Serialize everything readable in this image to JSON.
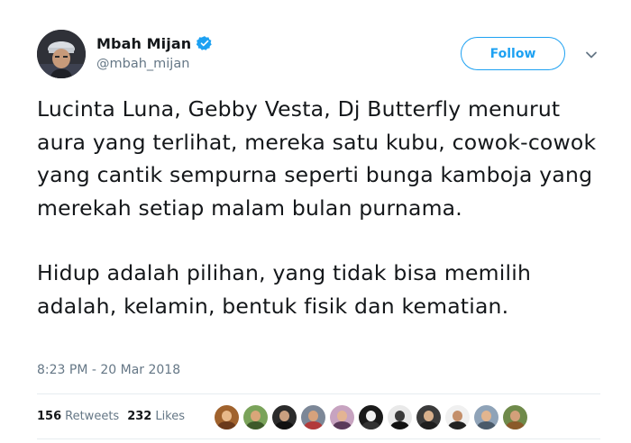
{
  "user": {
    "display_name": "Mbah Mijan",
    "handle": "@mbah_mijan",
    "verified": true,
    "avatar_icon": "profile-avatar"
  },
  "actions": {
    "follow_label": "Follow",
    "menu_icon": "chevron-down-icon"
  },
  "tweet": {
    "paragraphs": [
      "Lucinta Luna, Gebby Vesta, Dj Butterfly menurut aura yang terlihat, mereka satu kubu, cowok-cowok yang cantik sempurna seperti bunga kamboja yang merekah setiap malam bulan purnama.",
      "Hidup adalah pilihan, yang tidak bisa memilih adalah, kelamin, bentuk fisik dan kematian."
    ],
    "timestamp": "8:23 PM - 20 Mar 2018"
  },
  "stats": {
    "retweets_count": "156",
    "retweets_label": "Retweets",
    "likes_count": "232",
    "likes_label": "Likes"
  },
  "likers": [
    {
      "name": "liker-avatar-1",
      "bg": "#a0622d",
      "face": "#e8b98a",
      "body": "#6b3a1c"
    },
    {
      "name": "liker-avatar-2",
      "bg": "#7aa35a",
      "face": "#d9a679",
      "body": "#3e5a2a"
    },
    {
      "name": "liker-avatar-3",
      "bg": "#2b2b2b",
      "face": "#c9a080",
      "body": "#111111"
    },
    {
      "name": "liker-avatar-4",
      "bg": "#7c8797",
      "face": "#d6a27c",
      "body": "#b23a3a"
    },
    {
      "name": "liker-avatar-5",
      "bg": "#c7a3c0",
      "face": "#e3b493",
      "body": "#5a3a5a"
    },
    {
      "name": "liker-avatar-6",
      "bg": "#1a1a1a",
      "face": "#f2f2f2",
      "body": "#333333"
    },
    {
      "name": "liker-avatar-7",
      "bg": "#e9e9e9",
      "face": "#3a3a3a",
      "body": "#111111"
    },
    {
      "name": "liker-avatar-8",
      "bg": "#3b3b3b",
      "face": "#d8b08c",
      "body": "#1e1e1e"
    },
    {
      "name": "liker-avatar-9",
      "bg": "#f0f0f0",
      "face": "#c48f6a",
      "body": "#222222"
    },
    {
      "name": "liker-avatar-10",
      "bg": "#8fa3b8",
      "face": "#e2b58f",
      "body": "#4a5a6a"
    },
    {
      "name": "liker-avatar-11",
      "bg": "#6f8a4a",
      "face": "#d3a07a",
      "body": "#8a5a2a"
    }
  ],
  "colors": {
    "accent": "#1da1f2",
    "text_primary": "#14171a",
    "text_secondary": "#657786",
    "divider": "#e6ecf0"
  }
}
